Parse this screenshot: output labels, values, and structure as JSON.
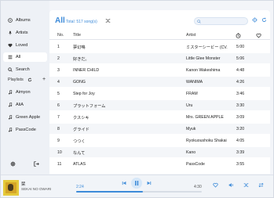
{
  "sidebar": {
    "items": [
      {
        "label": "Albums",
        "icon": "album-icon"
      },
      {
        "label": "Artists",
        "icon": "mic-icon"
      },
      {
        "label": "Loved",
        "icon": "heart-icon"
      },
      {
        "label": "All",
        "icon": "list-icon"
      },
      {
        "label": "Search",
        "icon": "search-icon"
      }
    ],
    "playlists_label": "Playlists",
    "playlists": [
      "Aimyon",
      "AliA",
      "Green Apple",
      "PassCode"
    ]
  },
  "main": {
    "title": "All",
    "subtitle": "Total: 517 song(s)",
    "columns": {
      "no": "No.",
      "title": "Title",
      "artist": "Artist"
    },
    "rows": [
      {
        "no": "1",
        "title": "夢幻鳴",
        "artist": "ミスターシービー (CV.",
        "dur": "5:00"
      },
      {
        "no": "2",
        "title": "好きだ。",
        "artist": "Little Glee Monster",
        "dur": "5:06"
      },
      {
        "no": "3",
        "title": "INNER CHILD",
        "artist": "Kanon Wakeshima",
        "dur": "4:48"
      },
      {
        "no": "4",
        "title": "GONG",
        "artist": "WANIMA",
        "dur": "4:26"
      },
      {
        "no": "5",
        "title": "Step for Joy",
        "artist": "FRAM",
        "dur": "3:46"
      },
      {
        "no": "6",
        "title": "プラットフォーム",
        "artist": "Uru",
        "dur": "3:30"
      },
      {
        "no": "7",
        "title": "クスシキ",
        "artist": "Mrs. GREEN APPLE",
        "dur": "3:09"
      },
      {
        "no": "8",
        "title": "グライド",
        "artist": "Myuk",
        "dur": "3:20"
      },
      {
        "no": "9",
        "title": "つつく",
        "artist": "Ryokuoushoku Shakai",
        "dur": "4:05"
      },
      {
        "no": "10",
        "title": "なんて",
        "artist": "Kano",
        "dur": "3:39"
      },
      {
        "no": "11",
        "title": "ATLAS",
        "artist": "PassCode",
        "dur": "3:55"
      }
    ]
  },
  "player": {
    "song": "栞",
    "artist": "SEKAI NO OWARI",
    "current": "2:24",
    "total": "4:30",
    "progress": 0.53
  },
  "colors": {
    "accent": "#3d8bd9",
    "sidebar": "#eef1f6",
    "panel": "#ffffff"
  }
}
